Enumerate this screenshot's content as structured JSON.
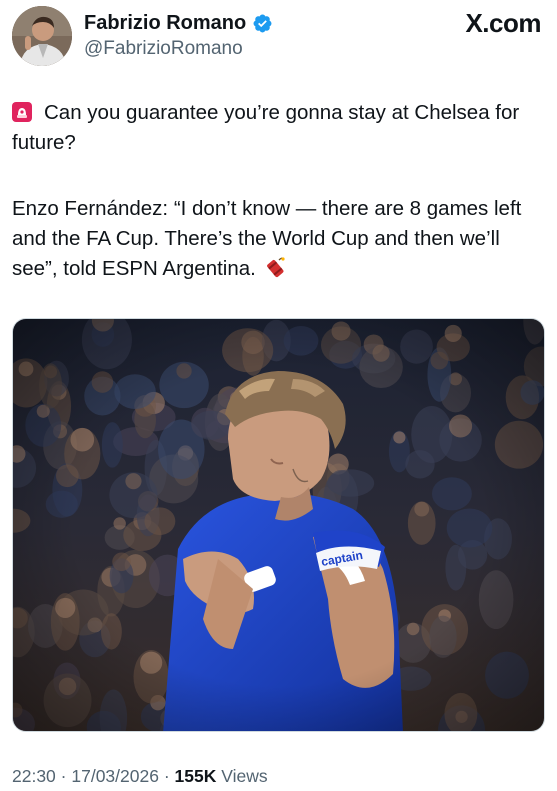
{
  "author": {
    "display_name": "Fabrizio Romano",
    "handle": "@FabrizioRomano",
    "verified": true,
    "avatar_icon": "profile-photo-avatar"
  },
  "brand": "X.com",
  "tweet": {
    "lead_emoji": "siren-icon",
    "question": "Can you guarantee you’re gonna stay at Chelsea for future?",
    "quote_line": "Enzo Fernández: “I don’t know — there are 8 games left and the FA Cup. There’s the World Cup and then we’ll see”, told ESPN Argentina.",
    "trailing_emoji": "firecracker-icon"
  },
  "media": {
    "kit_color": "#1f43c9",
    "armband_text": "captain"
  },
  "meta": {
    "time": "22:30",
    "date": "17/03/2026",
    "separator": "·",
    "views_count": "155K",
    "views_label": "Views"
  },
  "colors": {
    "text": "#0f1419",
    "secondary": "#536471",
    "verified_badge": "#1d9bf0"
  }
}
